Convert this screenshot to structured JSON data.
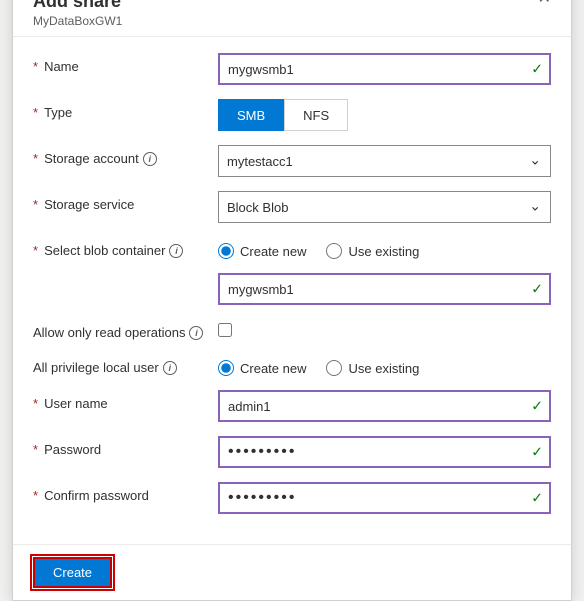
{
  "dialog": {
    "title": "Add share",
    "subtitle": "MyDataBoxGW1",
    "close_label": "✕"
  },
  "fields": {
    "name": {
      "label": "Name",
      "required": true,
      "value": "mygwsmb1",
      "has_check": true
    },
    "type": {
      "label": "Type",
      "required": true,
      "options": [
        "SMB",
        "NFS"
      ],
      "selected": "SMB"
    },
    "storage_account": {
      "label": "Storage account",
      "required": true,
      "value": "mytestacc1",
      "has_info": true
    },
    "storage_service": {
      "label": "Storage service",
      "required": true,
      "value": "Block Blob"
    },
    "blob_container": {
      "label": "Select blob container",
      "required": true,
      "has_info": true,
      "radio_create": "Create new",
      "radio_use": "Use existing",
      "selected": "create",
      "container_value": "mygwsmb1",
      "has_check": true
    },
    "allow_read": {
      "label": "Allow only read operations",
      "has_info": true,
      "checked": false
    },
    "privilege_user": {
      "label": "All privilege local user",
      "has_info": true,
      "radio_create": "Create new",
      "radio_use": "Use existing",
      "selected": "create"
    },
    "username": {
      "label": "User name",
      "required": true,
      "value": "admin1",
      "has_check": true
    },
    "password": {
      "label": "Password",
      "required": true,
      "value": "••••••••",
      "has_check": true
    },
    "confirm_password": {
      "label": "Confirm password",
      "required": true,
      "value": "••••••••",
      "has_check": true
    }
  },
  "footer": {
    "create_label": "Create"
  },
  "info_icon_label": "i"
}
